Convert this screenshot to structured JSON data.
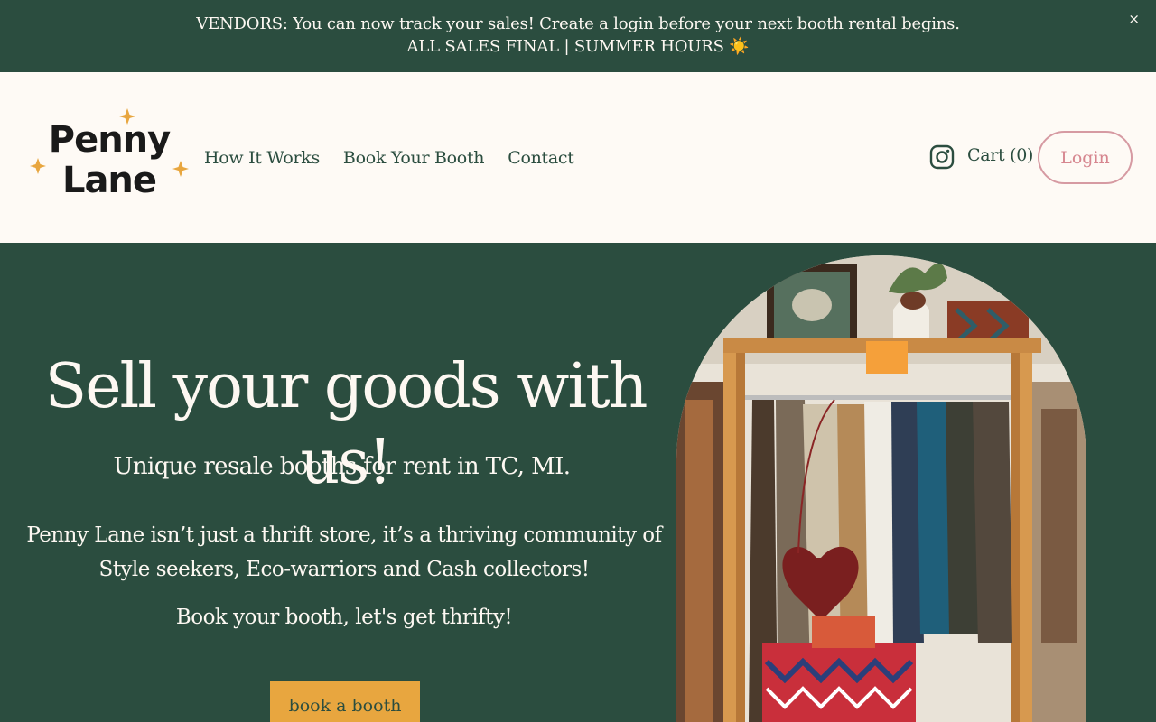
{
  "announcement": {
    "line1": "VENDORS: You can now track your sales! Create a login before your next booth rental begins.",
    "line2": "ALL SALES FINAL | SUMMER HOURS ☀️",
    "close_label": "×"
  },
  "header": {
    "logo_text": [
      "Penny",
      "Lane"
    ],
    "nav": [
      {
        "label": "How It Works"
      },
      {
        "label": "Book Your Booth"
      },
      {
        "label": "Contact"
      }
    ],
    "cart_label": "Cart (0)",
    "login_label": "Login",
    "social_icon": "instagram-icon"
  },
  "hero": {
    "title": "Sell your goods with us!",
    "subtitle": "Unique resale booths for rent in TC, MI.",
    "paragraph_line1": "Penny Lane isn’t just a thrift store, it’s a thriving community of",
    "paragraph_line2": "Style seekers, Eco-warriors and Cash collectors!",
    "cta_text": "Book your booth, let's get thrifty!",
    "button_label": "book a booth"
  },
  "colors": {
    "primary_green": "#2b4d3f",
    "cream": "#fefaf5",
    "accent_gold": "#e8a63f",
    "login_pink": "#d69aa2"
  }
}
